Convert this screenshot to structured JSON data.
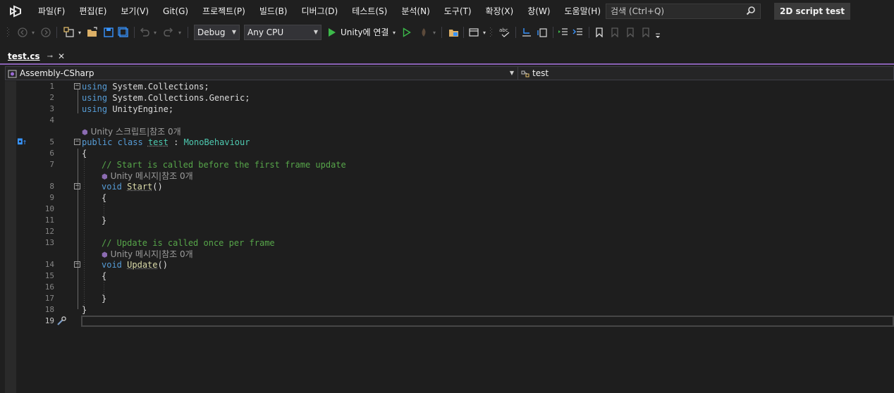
{
  "menu": {
    "items": [
      "파일(F)",
      "편집(E)",
      "보기(V)",
      "Git(G)",
      "프로젝트(P)",
      "빌드(B)",
      "디버그(D)",
      "테스트(S)",
      "분석(N)",
      "도구(T)",
      "확장(X)",
      "창(W)",
      "도움말(H)"
    ],
    "search_placeholder": "검색 (Ctrl+Q)",
    "solution_title": "2D script test"
  },
  "toolbar": {
    "config_value": "Debug",
    "platform_value": "Any CPU",
    "run_label": "Unity에 연결"
  },
  "tabs": [
    {
      "label": "test.cs",
      "active": true
    }
  ],
  "navbar": {
    "project": "Assembly-CSharp",
    "member": "test"
  },
  "editor": {
    "lines": [
      {
        "num": "1",
        "code": "using System.Collections;"
      },
      {
        "num": "2",
        "code": "using System.Collections.Generic;"
      },
      {
        "num": "3",
        "code": "using UnityEngine;"
      },
      {
        "num": "4",
        "code": ""
      },
      {
        "num": "5",
        "code": "public class test : MonoBehaviour"
      },
      {
        "num": "6",
        "code": "{"
      },
      {
        "num": "7",
        "code": "// Start is called before the first frame update"
      },
      {
        "num": "8",
        "code": "void Start()"
      },
      {
        "num": "9",
        "code": "{"
      },
      {
        "num": "10",
        "code": ""
      },
      {
        "num": "11",
        "code": "}"
      },
      {
        "num": "12",
        "code": ""
      },
      {
        "num": "13",
        "code": "// Update is called once per frame"
      },
      {
        "num": "14",
        "code": "void Update()"
      },
      {
        "num": "15",
        "code": "{"
      },
      {
        "num": "16",
        "code": ""
      },
      {
        "num": "17",
        "code": "}"
      },
      {
        "num": "18",
        "code": "}"
      },
      {
        "num": "19",
        "code": ""
      }
    ],
    "lens": {
      "class_lens": "Unity 스크립트|참조 0개",
      "start_lens": "Unity 메시지|참조 0개",
      "update_lens": "Unity 메시지|참조 0개"
    },
    "tokens": {
      "using": "using",
      "ns1": "System.Collections;",
      "ns2": "System.Collections.Generic;",
      "ns3": "UnityEngine;",
      "public": "public",
      "class": "class",
      "classname": "test",
      "colon": ":",
      "base": "MonoBehaviour",
      "void": "void",
      "start": "Start",
      "update": "Update",
      "parens": "()",
      "open": "{",
      "close": "}",
      "start_comment": "// Start is called before the first frame update",
      "update_comment": "// Update is called once per frame"
    }
  },
  "colors": {
    "keyword": "#569cd6",
    "type": "#4ec9b0",
    "comment": "#57a64a",
    "method": "#dcdcaa",
    "accent": "#8860b4"
  }
}
